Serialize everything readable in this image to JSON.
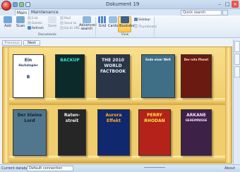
{
  "window": {
    "title": "Dokument 19"
  },
  "tabs": [
    {
      "label": "Main"
    },
    {
      "label": "Maintenance"
    }
  ],
  "search": {
    "placeholder": "Quick search"
  },
  "ribbon": {
    "documents": {
      "group_label": "Documents",
      "add_label": "Add",
      "scan_label": "Scan",
      "small": [
        {
          "label": "Edit",
          "enabled": false
        },
        {
          "label": "Delete",
          "enabled": false
        },
        {
          "label": "Refresh",
          "enabled": true
        },
        {
          "label": "Save",
          "enabled": false
        },
        {
          "label": "Mail",
          "enabled": false
        },
        {
          "label": "Send to",
          "enabled": false
        },
        {
          "label": "Go to URL",
          "enabled": false
        }
      ],
      "advanced_label": "Advanced search"
    },
    "view": {
      "group_label": "View",
      "grid_label": "Grid",
      "cards_label": "Cards",
      "bookshelf_label": "Bookshelf",
      "sidebar_label": "Sidebar",
      "thumbnails_label": "Thumbnails"
    }
  },
  "nav": {
    "previous_label": "Previous",
    "next_label": "Next"
  },
  "books": [
    {
      "lines": [
        "Ein",
        "Hochstapler",
        "",
        "B"
      ],
      "cover": "#ffffff",
      "fg": "#223355"
    },
    {
      "lines": [
        "BACKUP"
      ],
      "cover": "#0d2a2a",
      "fg": "#39e0d0"
    },
    {
      "lines": [
        "THE 2010",
        "WORLD",
        "FACTBOOK"
      ],
      "cover": "#2a3548",
      "fg": "#e6edf5"
    },
    {
      "lines": [
        "Ende einer Welt"
      ],
      "cover": "#3e6f86",
      "fg": "#ffffff"
    },
    {
      "lines": [
        "Der rote Planet"
      ],
      "cover": "#6a1a10",
      "fg": "#ffe7c8"
    },
    {
      "lines": [
        "Der kleine",
        "Lord"
      ],
      "cover": "#51778e",
      "fg": "#10202e"
    },
    {
      "lines": [
        "Raten-",
        "streit"
      ],
      "cover": "#262626",
      "fg": "#f2f2f2"
    },
    {
      "lines": [
        "Aurora",
        "Effekt"
      ],
      "cover": "#10286e",
      "fg": "#ffb020"
    },
    {
      "lines": [
        "PERRY",
        "RHODAN"
      ],
      "cover": "#b5221a",
      "fg": "#ffe04a"
    },
    {
      "lines": [
        "ARKANE",
        "GEHEIMNISSE"
      ],
      "cover": "#3d2146",
      "fg": "#ffd9ff"
    }
  ],
  "side_tabs": [
    {
      "label": "Labels"
    },
    {
      "label": "Sidebar"
    },
    {
      "label": "Preview"
    }
  ],
  "status": {
    "db_label": "Current database:",
    "db_value": "Default connection",
    "about_label": "About"
  },
  "colors": {
    "shelf": "#f0ce6e",
    "accent": "#ffc84a",
    "app_orb": "#d8342a"
  }
}
